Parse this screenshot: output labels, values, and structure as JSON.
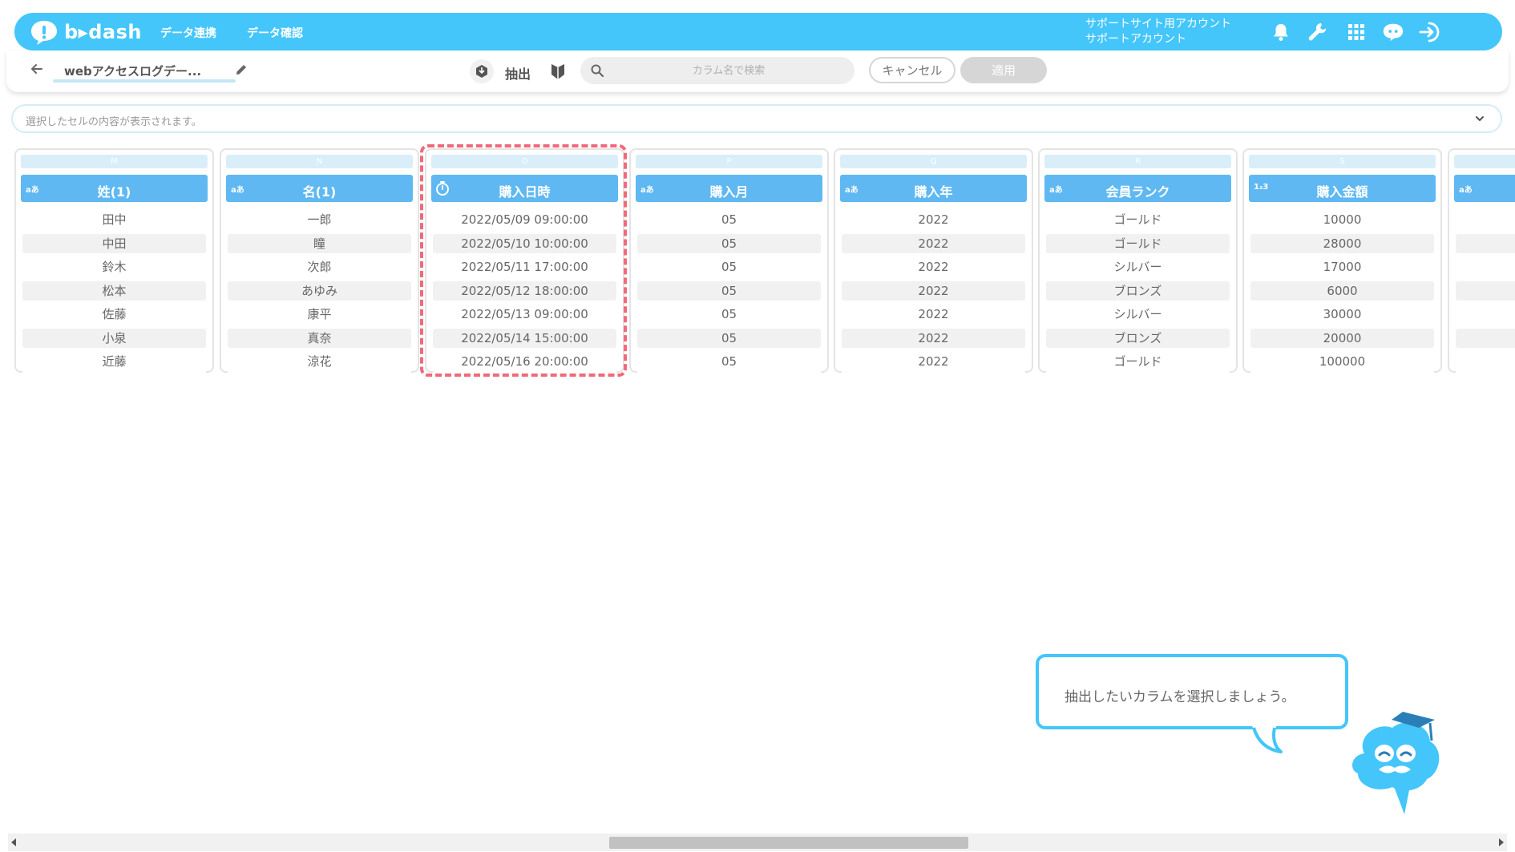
{
  "header": {
    "logo_text": "b▸dash",
    "nav": [
      "データ連携",
      "データ確認"
    ],
    "account_line1": "サポートサイト用アカウント",
    "account_line2": "サポートアカウント",
    "icons": [
      "bell-icon",
      "wrench-icon",
      "apps-grid-icon",
      "chat-icon",
      "logout-icon"
    ]
  },
  "toolbar": {
    "doc_title": "webアクセスログデー...",
    "mode_label": "抽出",
    "search_placeholder": "カラム名で検索",
    "cancel_label": "キャンセル",
    "apply_label": "適用"
  },
  "cell_bar": {
    "placeholder": "選択したセルの内容が表示されます。"
  },
  "columns": [
    {
      "letter": "M",
      "type": "aあ",
      "name": "姓(1)",
      "values": [
        "田中",
        "中田",
        "鈴木",
        "松本",
        "佐藤",
        "小泉",
        "近藤"
      ]
    },
    {
      "letter": "N",
      "type": "aあ",
      "name": "名(1)",
      "values": [
        "一郎",
        "瞳",
        "次郎",
        "あゆみ",
        "康平",
        "真奈",
        "涼花"
      ]
    },
    {
      "letter": "O",
      "type": "datetime",
      "name": "購入日時",
      "values": [
        "2022/05/09 09:00:00",
        "2022/05/10 10:00:00",
        "2022/05/11 17:00:00",
        "2022/05/12 18:00:00",
        "2022/05/13 09:00:00",
        "2022/05/14 15:00:00",
        "2022/05/16 20:00:00"
      ]
    },
    {
      "letter": "P",
      "type": "aあ",
      "name": "購入月",
      "values": [
        "05",
        "05",
        "05",
        "05",
        "05",
        "05",
        "05"
      ]
    },
    {
      "letter": "Q",
      "type": "aあ",
      "name": "購入年",
      "values": [
        "2022",
        "2022",
        "2022",
        "2022",
        "2022",
        "2022",
        "2022"
      ]
    },
    {
      "letter": "R",
      "type": "aあ",
      "name": "会員ランク",
      "values": [
        "ゴールド",
        "ゴールド",
        "シルバー",
        "ブロンズ",
        "シルバー",
        "ブロンズ",
        "ゴールド"
      ]
    },
    {
      "letter": "S",
      "type": "1₂3",
      "name": "購入金額",
      "values": [
        "10000",
        "28000",
        "17000",
        "6000",
        "30000",
        "20000",
        "100000"
      ]
    },
    {
      "letter": "",
      "type": "aあ",
      "name": "",
      "values": [
        "",
        "",
        "",
        "",
        "",
        "",
        ""
      ]
    }
  ],
  "tooltip": {
    "text": "抽出したいカラムを選択しましょう。"
  },
  "colors": {
    "brand": "#44c6fb",
    "column_header": "#5fb8f2",
    "highlight": "#f06a7a"
  }
}
